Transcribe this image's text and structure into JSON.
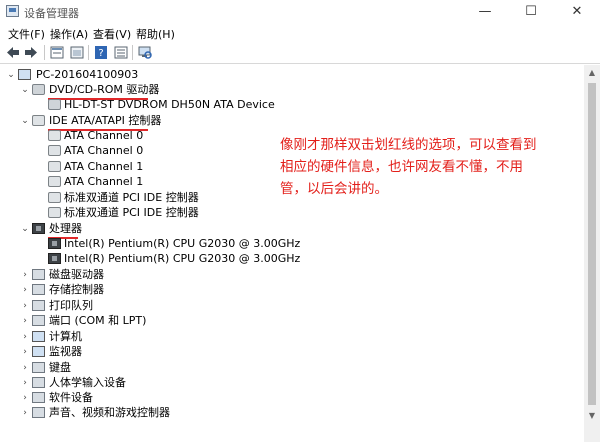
{
  "window": {
    "title": "设备管理器",
    "minimize": "—",
    "maximize": "☐",
    "close": "✕"
  },
  "menu": [
    "文件(F)",
    "操作(A)",
    "查看(V)",
    "帮助(H)"
  ],
  "toolbar_icons": [
    "back-icon",
    "forward-icon",
    "properties-icon",
    "show-hide-icon",
    "help-icon",
    "view-icon",
    "scan-hardware-icon"
  ],
  "tree": {
    "root": "PC-201604100903",
    "groups": [
      {
        "label": "DVD/CD-ROM 驱动器",
        "expanded": true,
        "icon": "dvd-icon",
        "children": [
          "HL-DT-ST DVDROM DH50N ATA Device"
        ]
      },
      {
        "label": "IDE ATA/ATAPI 控制器",
        "expanded": true,
        "icon": "ide-controller-icon",
        "children": [
          "ATA Channel 0",
          "ATA Channel 0",
          "ATA Channel 1",
          "ATA Channel 1",
          "标准双通道 PCI IDE 控制器",
          "标准双通道 PCI IDE 控制器"
        ]
      },
      {
        "label": "处理器",
        "expanded": true,
        "icon": "processor-icon",
        "children": [
          "Intel(R) Pentium(R) CPU G2030 @ 3.00GHz",
          "Intel(R) Pentium(R) CPU G2030 @ 3.00GHz"
        ]
      },
      {
        "label": "磁盘驱动器",
        "expanded": false,
        "icon": "disk-icon",
        "children": []
      },
      {
        "label": "存储控制器",
        "expanded": false,
        "icon": "storage-icon",
        "children": []
      },
      {
        "label": "打印队列",
        "expanded": false,
        "icon": "printer-icon",
        "children": []
      },
      {
        "label": "端口 (COM 和 LPT)",
        "expanded": false,
        "icon": "port-icon",
        "children": []
      },
      {
        "label": "计算机",
        "expanded": false,
        "icon": "computer-icon",
        "children": []
      },
      {
        "label": "监视器",
        "expanded": false,
        "icon": "monitor-icon",
        "children": []
      },
      {
        "label": "键盘",
        "expanded": false,
        "icon": "keyboard-icon",
        "children": []
      },
      {
        "label": "人体学输入设备",
        "expanded": false,
        "icon": "hid-icon",
        "children": []
      },
      {
        "label": "软件设备",
        "expanded": false,
        "icon": "software-device-icon",
        "children": []
      },
      {
        "label": "声音、视频和游戏控制器",
        "expanded": false,
        "icon": "audio-icon",
        "children": []
      }
    ]
  },
  "annotation": "像刚才那样双击划红线的选项，可以查看到相应的硬件信息，也许网友看不懂，不用管，以后会讲的。",
  "colors": {
    "annotation": "#e3201b",
    "underline": "#e0282a"
  }
}
